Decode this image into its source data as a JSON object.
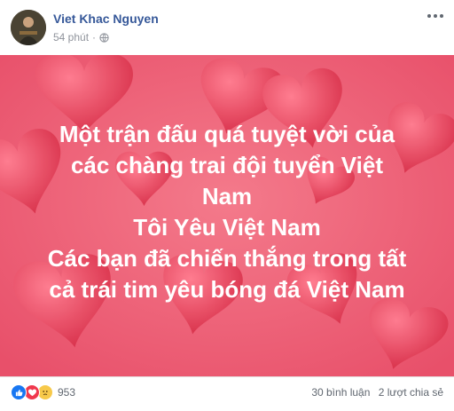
{
  "author": {
    "name": "Viet Khac Nguyen"
  },
  "post": {
    "time": "54 phút",
    "privacy_icon": "globe-icon",
    "lines": [
      "Một trận đấu quá tuyệt vời của",
      "các chàng trai đội tuyển Việt",
      "Nam",
      "Tôi Yêu Việt Nam",
      "Các bạn đã chiến thắng trong tất",
      "cả trái tim yêu bóng đá Việt Nam"
    ]
  },
  "reactions": {
    "icons": [
      "like-icon",
      "love-icon",
      "sad-icon"
    ],
    "count": "953"
  },
  "stats": {
    "comments": "30 bình luận",
    "shares": "2 lượt chia sẻ"
  },
  "colors": {
    "background": "#ee5f74",
    "heart": "#e33a52",
    "author": "#365899"
  }
}
